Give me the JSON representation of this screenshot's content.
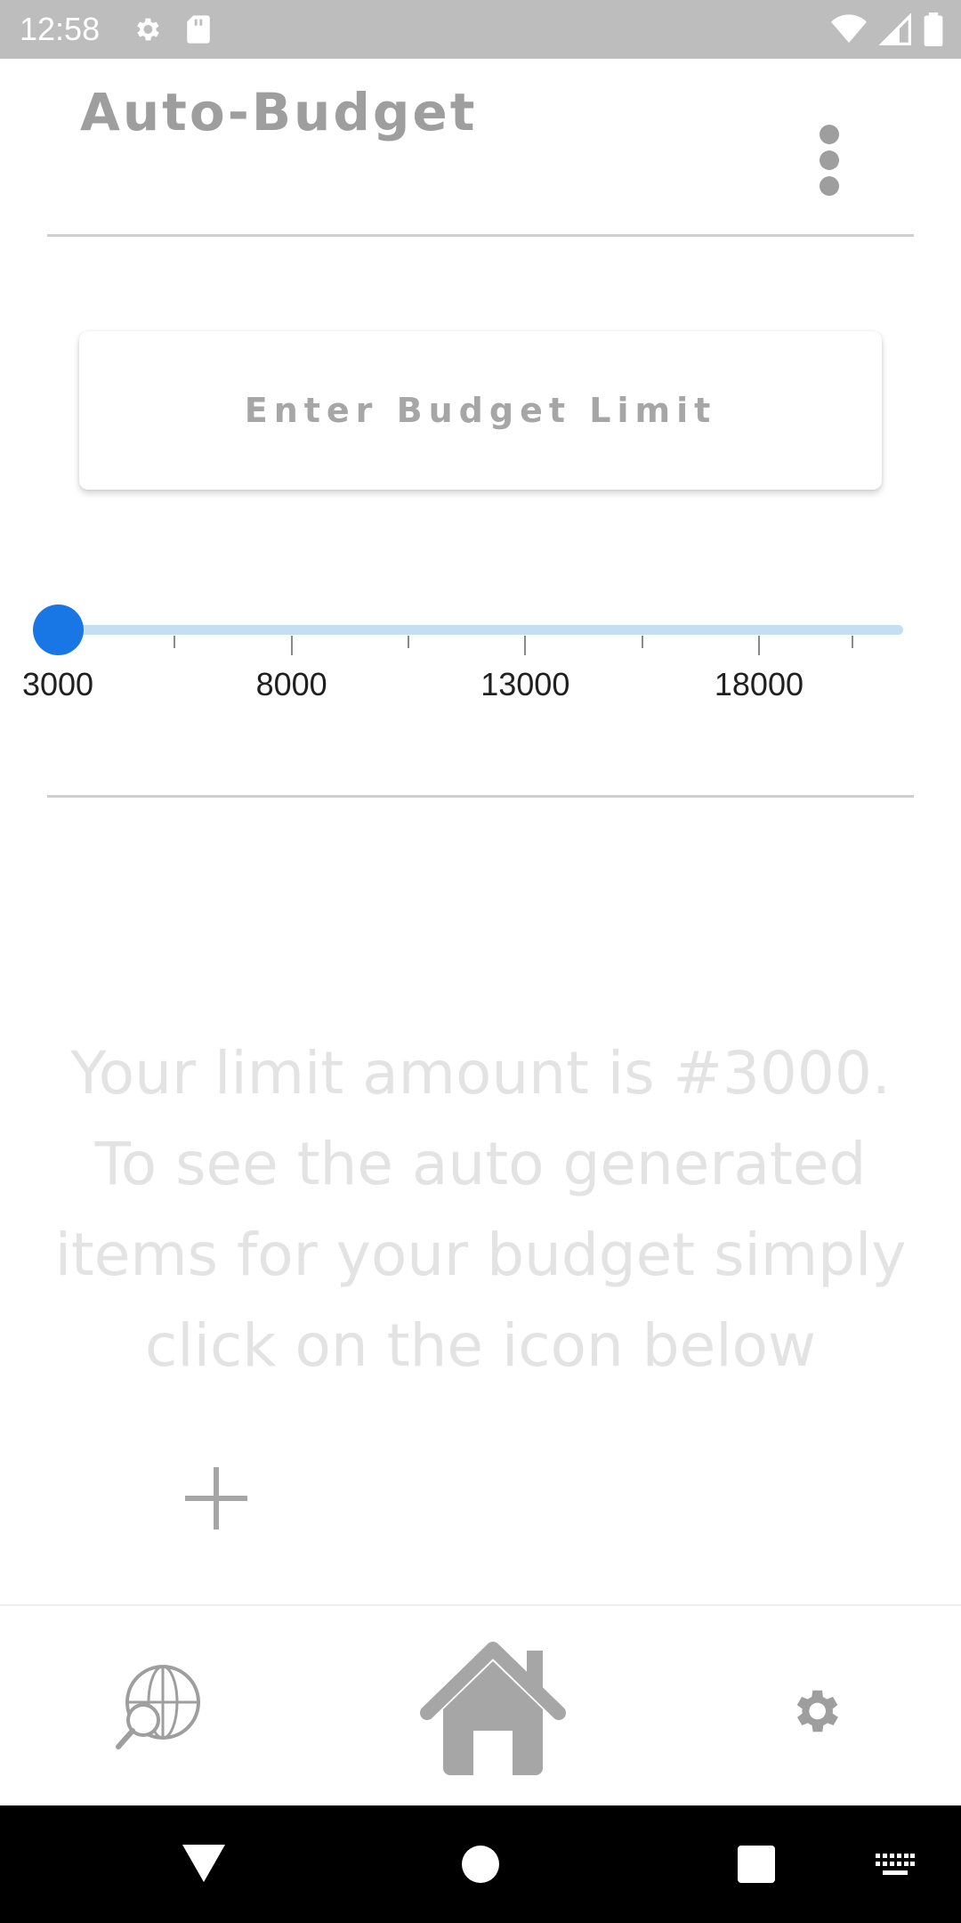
{
  "status_bar": {
    "time": "12:58",
    "left_icons": [
      "gear-icon",
      "sd-card-icon"
    ],
    "right_icons": [
      "wifi-icon",
      "cell-signal-icon",
      "battery-icon"
    ]
  },
  "header": {
    "title": "Auto-Budget",
    "menu_icon": "more-vert-icon"
  },
  "budget_input": {
    "placeholder": "Enter Budget Limit"
  },
  "slider": {
    "min": 3000,
    "max": 20000,
    "value": 3000,
    "labels": [
      "3000",
      "8000",
      "13000",
      "18000"
    ]
  },
  "message": {
    "text": "Your limit amount is #3000.\nTo see the auto generated\nitems for your budget simply\nclick  on the icon below"
  },
  "add_button": {
    "icon": "plus-icon"
  },
  "bottom_nav": {
    "items": [
      {
        "icon": "globe-search-icon",
        "active": false
      },
      {
        "icon": "home-icon",
        "active": true
      },
      {
        "icon": "settings-gear-icon",
        "active": false
      }
    ]
  },
  "system_nav": {
    "buttons": [
      "back-icon",
      "home-circle-icon",
      "recents-icon",
      "keyboard-icon"
    ]
  },
  "colors": {
    "accent": "#1877e5",
    "track": "#c4def4",
    "muted_text": "#9e9e9e",
    "faint_text": "#e3e3e3"
  }
}
